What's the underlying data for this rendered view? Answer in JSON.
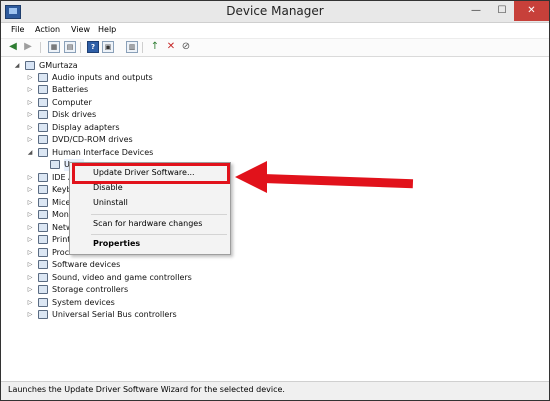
{
  "window": {
    "title": "Device Manager",
    "min": "—",
    "max": "☐",
    "close": "✕"
  },
  "menu": [
    "File",
    "Action",
    "View",
    "Help"
  ],
  "toolbar": {
    "back": "◀",
    "forward": "▶",
    "properties": "▦",
    "sheet": "▤",
    "help": "?",
    "view": "▣",
    "scan": "▥",
    "update": "↑",
    "uninstall": "✕",
    "disable": "⊘"
  },
  "tree": {
    "root": "GMurtaza",
    "categories": [
      "Audio inputs and outputs",
      "Batteries",
      "Computer",
      "Disk drives",
      "Display adapters",
      "DVD/CD-ROM drives",
      "Human Interface Devices",
      "U",
      "IDE A",
      "Keyb",
      "Mice",
      "Mon",
      "Netw",
      "Print queues",
      "Processors",
      "Software devices",
      "Sound, video and game controllers",
      "Storage controllers",
      "System devices",
      "Universal Serial Bus controllers"
    ],
    "expand_closed": "▷",
    "expand_open": "◢"
  },
  "context_menu": {
    "items": [
      "Update Driver Software...",
      "Disable",
      "Uninstall",
      "Scan for hardware changes",
      "Properties"
    ],
    "highlight_color": "#e1121b"
  },
  "status": "Launches the Update Driver Software Wizard for the selected device."
}
